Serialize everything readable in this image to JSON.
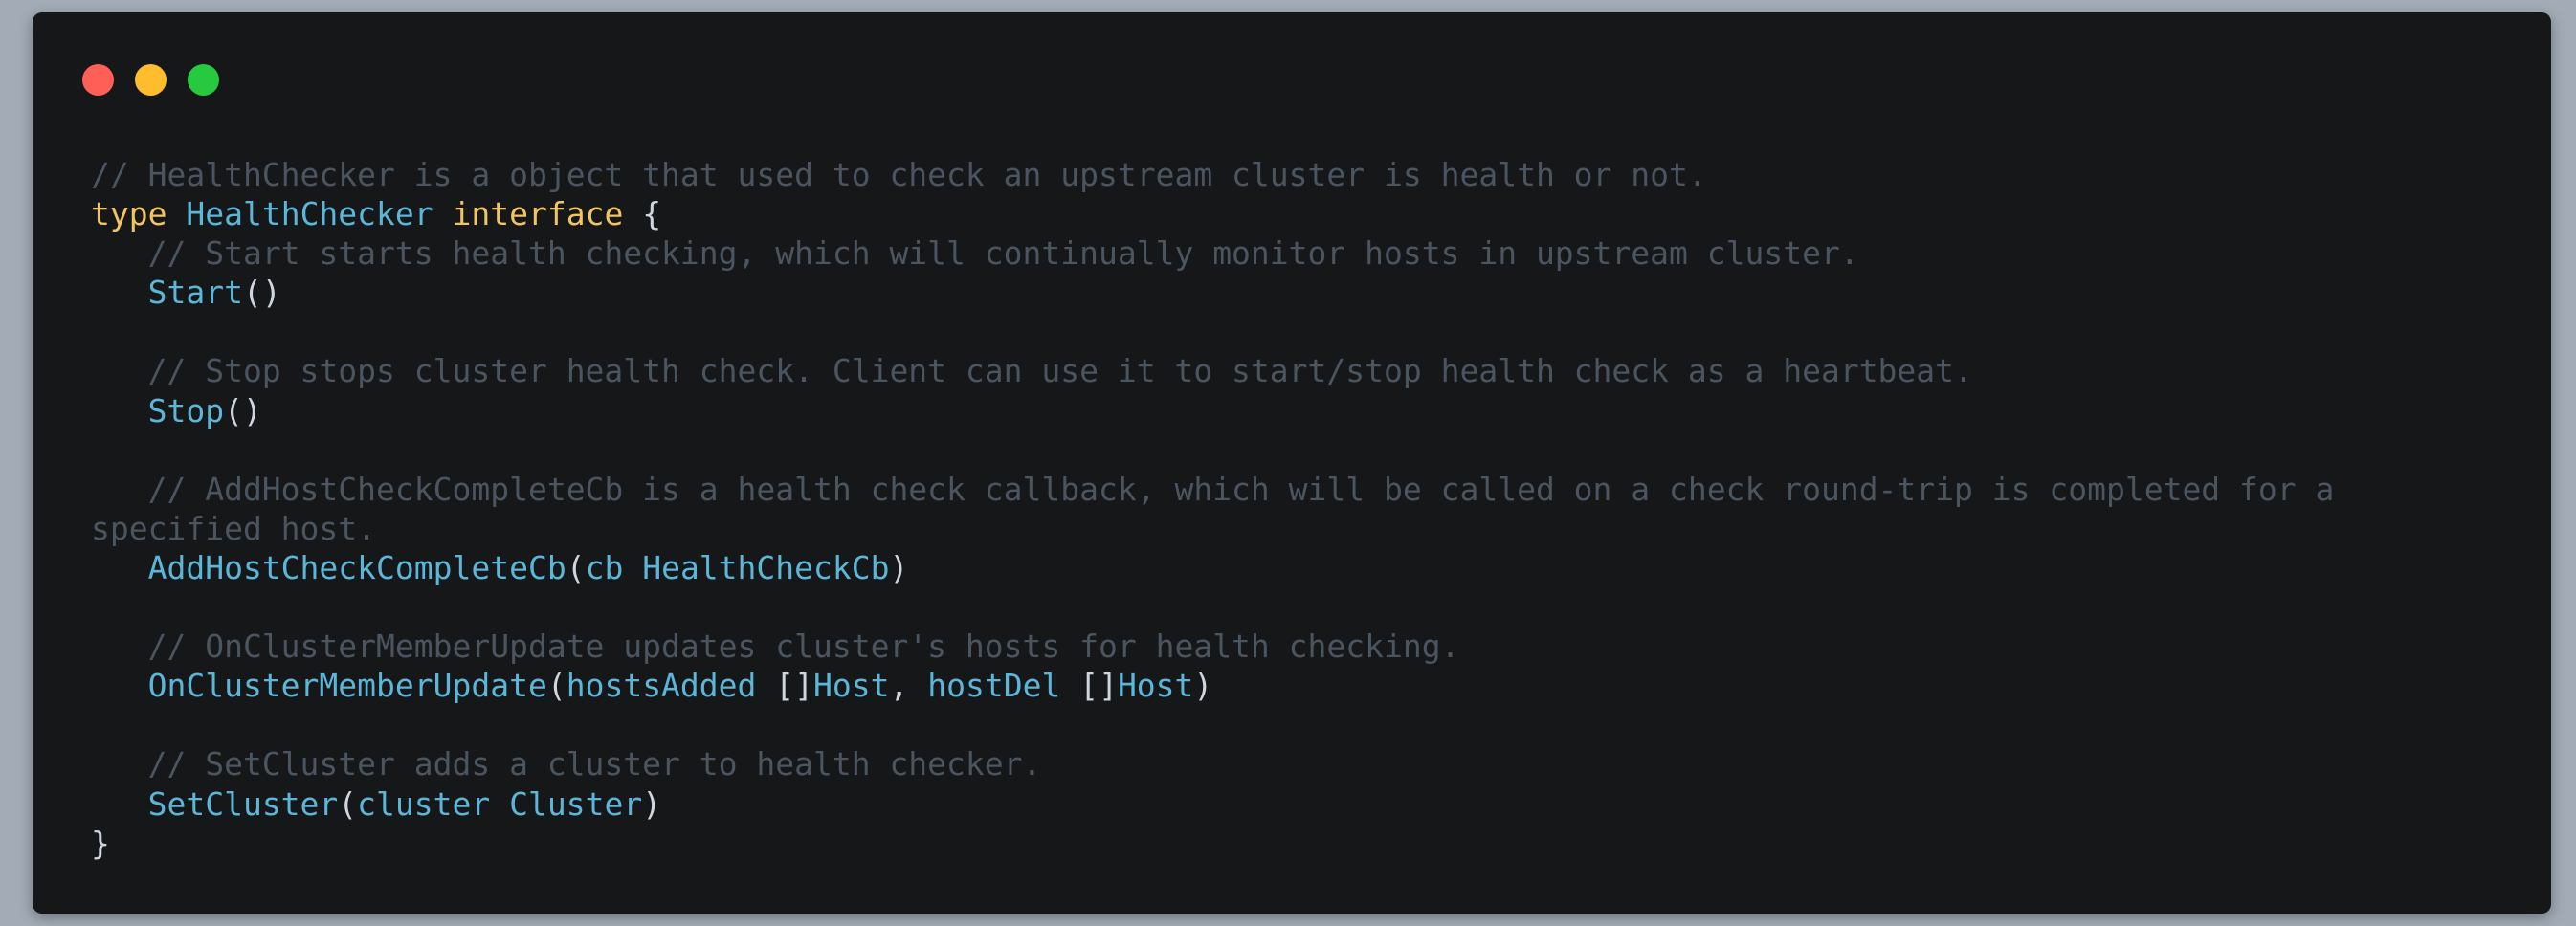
{
  "window": {
    "controls": {
      "close_color": "#ff5f56",
      "minimize_color": "#ffbd2e",
      "zoom_color": "#27c93f"
    }
  },
  "code": {
    "lines": [
      {
        "tokens": [
          {
            "t": "cmt",
            "v": "// HealthChecker is a object that used to check an upstream cluster is health or not."
          }
        ]
      },
      {
        "tokens": [
          {
            "t": "kw",
            "v": "type"
          },
          {
            "t": "punc",
            "v": " "
          },
          {
            "t": "typ",
            "v": "HealthChecker"
          },
          {
            "t": "punc",
            "v": " "
          },
          {
            "t": "kw",
            "v": "interface"
          },
          {
            "t": "punc",
            "v": " {"
          }
        ]
      },
      {
        "tokens": [
          {
            "t": "cmt",
            "v": "   // Start starts health checking, which will continually monitor hosts in upstream cluster."
          }
        ]
      },
      {
        "tokens": [
          {
            "t": "punc",
            "v": "   "
          },
          {
            "t": "fn",
            "v": "Start"
          },
          {
            "t": "punc",
            "v": "()"
          }
        ]
      },
      {
        "tokens": []
      },
      {
        "tokens": [
          {
            "t": "cmt",
            "v": "   // Stop stops cluster health check. Client can use it to start/stop health check as a heartbeat."
          }
        ]
      },
      {
        "tokens": [
          {
            "t": "punc",
            "v": "   "
          },
          {
            "t": "fn",
            "v": "Stop"
          },
          {
            "t": "punc",
            "v": "()"
          }
        ]
      },
      {
        "tokens": []
      },
      {
        "tokens": [
          {
            "t": "cmt",
            "v": "   // AddHostCheckCompleteCb is a health check callback, which will be called on a check round-trip is completed for a"
          }
        ]
      },
      {
        "tokens": [
          {
            "t": "cmt",
            "v": "specified host."
          }
        ]
      },
      {
        "tokens": [
          {
            "t": "punc",
            "v": "   "
          },
          {
            "t": "fn",
            "v": "AddHostCheckCompleteCb"
          },
          {
            "t": "punc",
            "v": "("
          },
          {
            "t": "param",
            "v": "cb"
          },
          {
            "t": "punc",
            "v": " "
          },
          {
            "t": "typ",
            "v": "HealthCheckCb"
          },
          {
            "t": "punc",
            "v": ")"
          }
        ]
      },
      {
        "tokens": []
      },
      {
        "tokens": [
          {
            "t": "cmt",
            "v": "   // OnClusterMemberUpdate updates cluster's hosts for health checking."
          }
        ]
      },
      {
        "tokens": [
          {
            "t": "punc",
            "v": "   "
          },
          {
            "t": "fn",
            "v": "OnClusterMemberUpdate"
          },
          {
            "t": "punc",
            "v": "("
          },
          {
            "t": "param",
            "v": "hostsAdded"
          },
          {
            "t": "punc",
            "v": " []"
          },
          {
            "t": "typ",
            "v": "Host"
          },
          {
            "t": "punc",
            "v": ", "
          },
          {
            "t": "param",
            "v": "hostDel"
          },
          {
            "t": "punc",
            "v": " []"
          },
          {
            "t": "typ",
            "v": "Host"
          },
          {
            "t": "punc",
            "v": ")"
          }
        ]
      },
      {
        "tokens": []
      },
      {
        "tokens": [
          {
            "t": "cmt",
            "v": "   // SetCluster adds a cluster to health checker."
          }
        ]
      },
      {
        "tokens": [
          {
            "t": "punc",
            "v": "   "
          },
          {
            "t": "fn",
            "v": "SetCluster"
          },
          {
            "t": "punc",
            "v": "("
          },
          {
            "t": "param",
            "v": "cluster"
          },
          {
            "t": "punc",
            "v": " "
          },
          {
            "t": "typ",
            "v": "Cluster"
          },
          {
            "t": "punc",
            "v": ")"
          }
        ]
      },
      {
        "tokens": [
          {
            "t": "punc",
            "v": "}"
          }
        ]
      }
    ]
  }
}
